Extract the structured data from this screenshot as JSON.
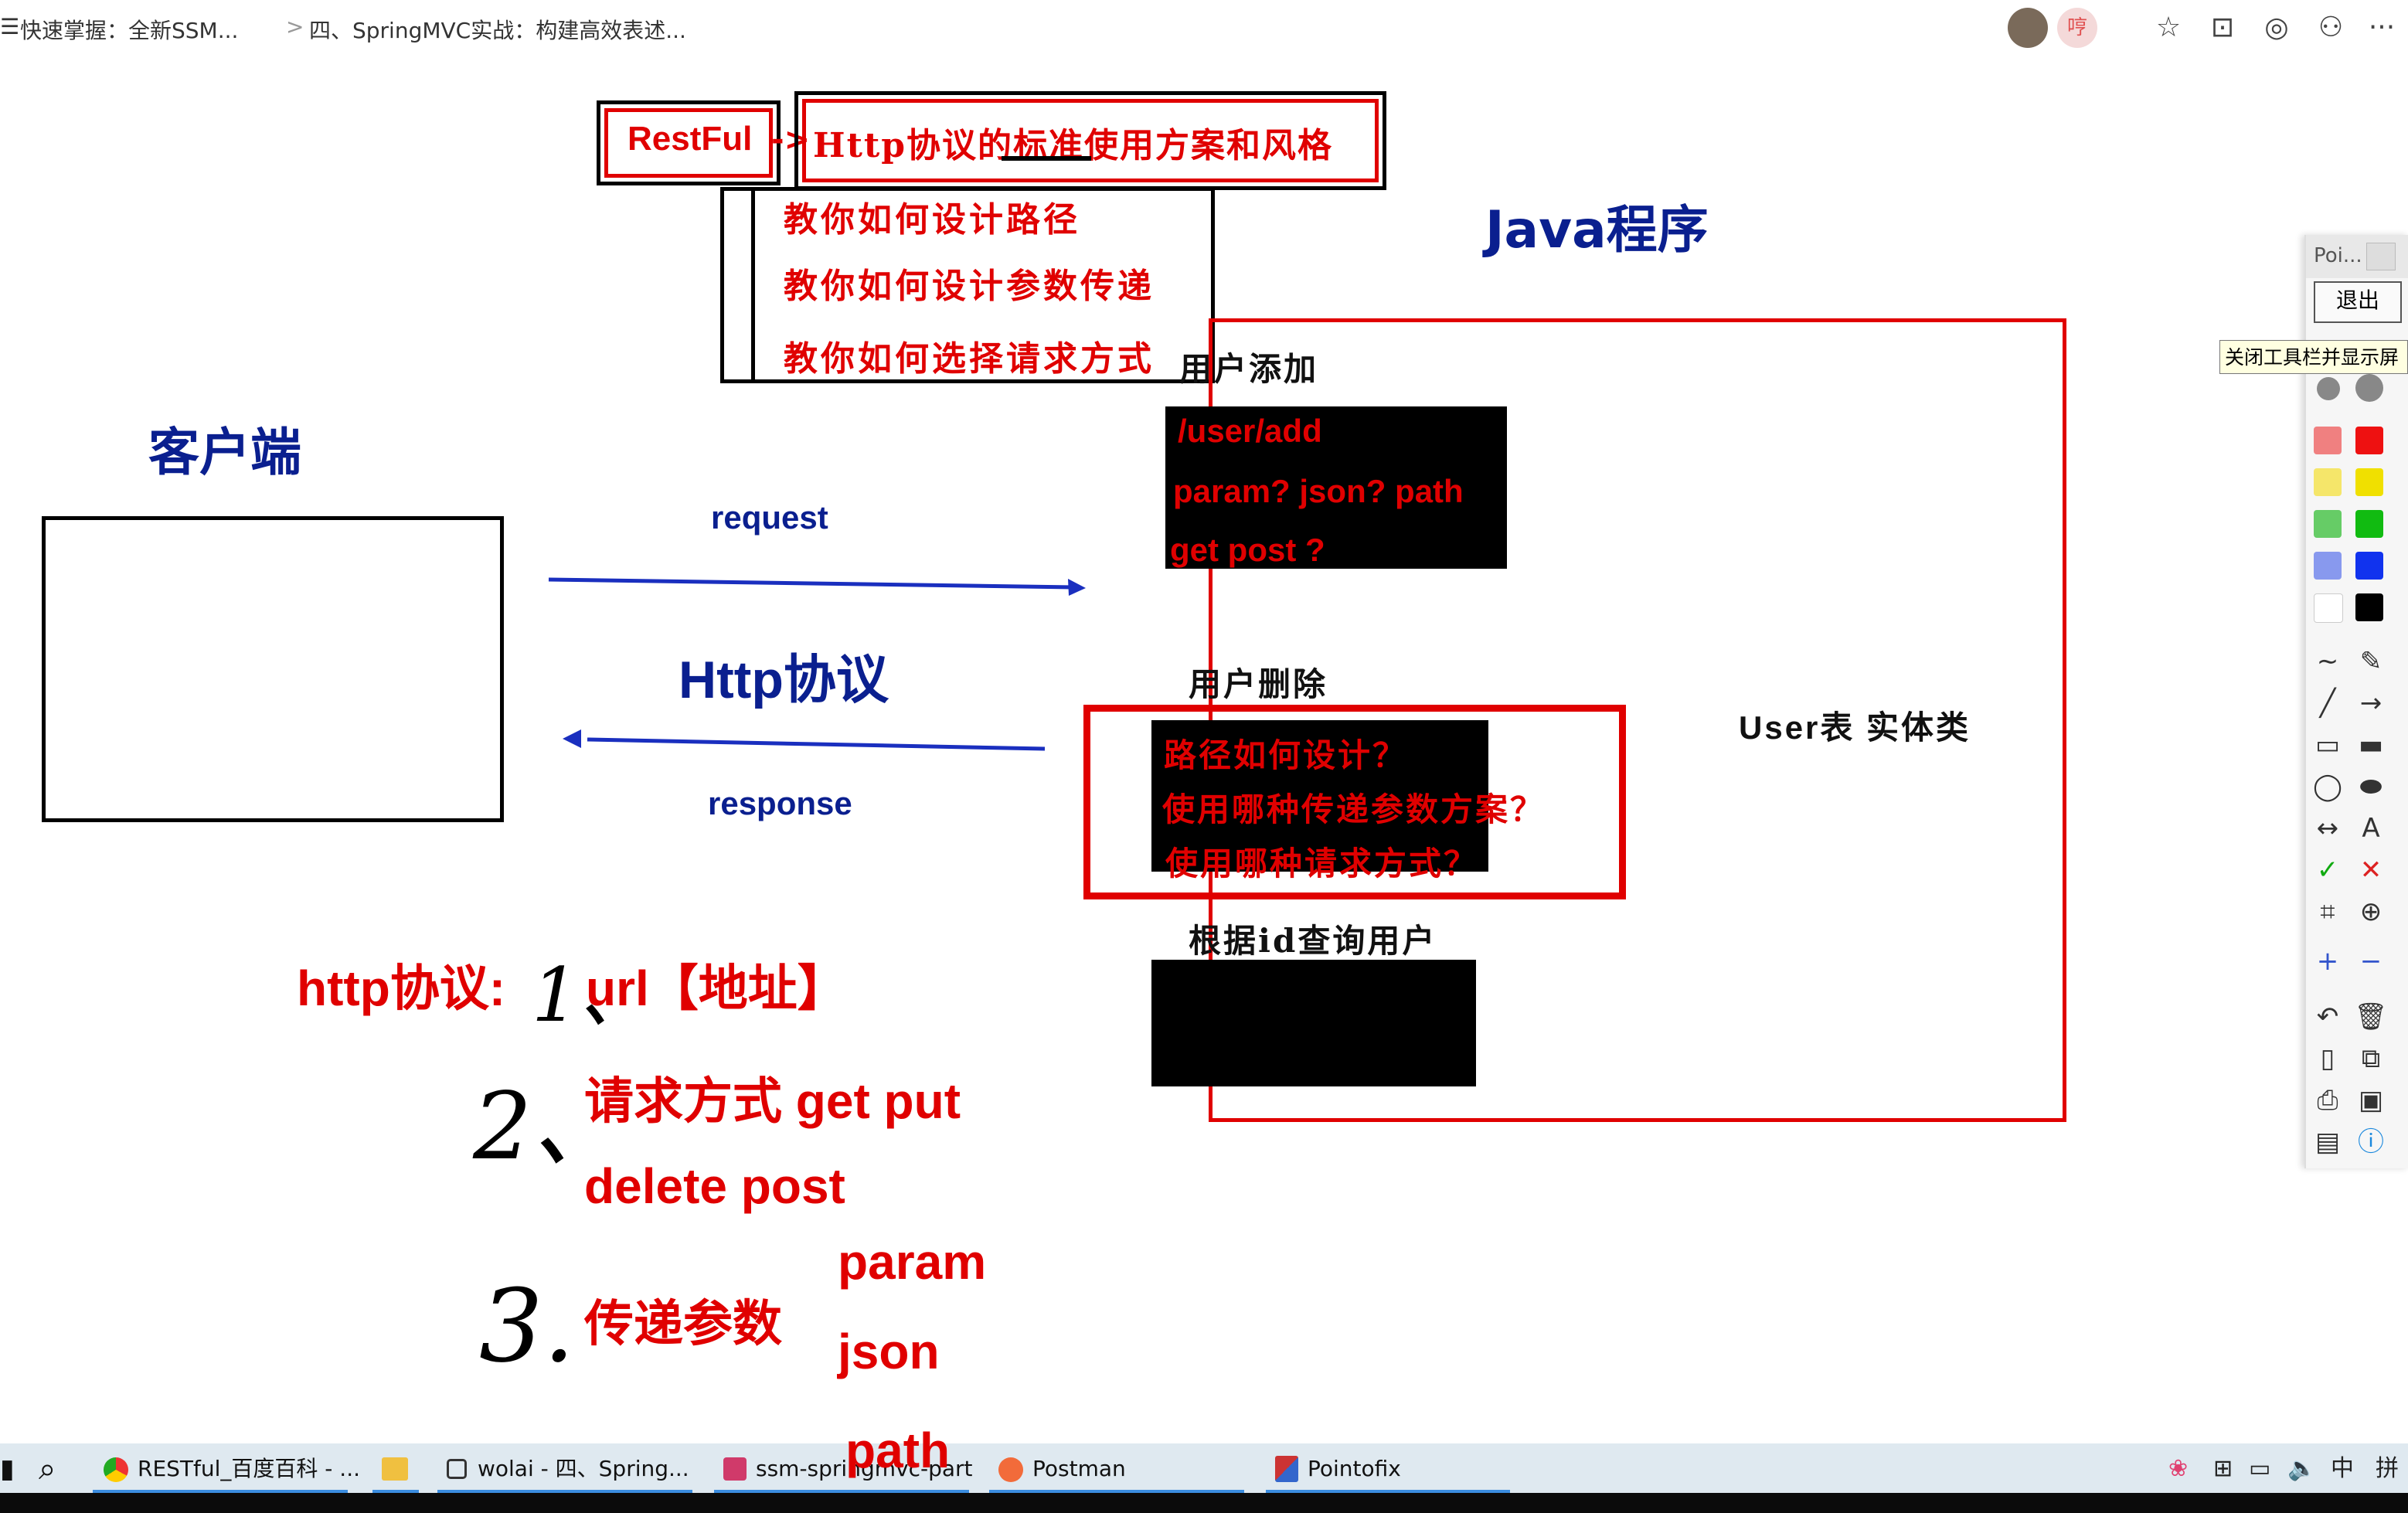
{
  "breadcrumb": {
    "menu_glyph": "☰",
    "item1": "快速掌握：全新SSM...",
    "sep": ">",
    "item2": "四、SpringMVC实战：构建高效表述..."
  },
  "topbar_icons": {
    "avatar_badge": "哼",
    "star": "☆",
    "comment": "⊡",
    "chat": "◎",
    "user": "⚇",
    "more": "···"
  },
  "slide": {
    "restful_label": "RestFul",
    "arrow": "->",
    "restful_desc": "Http协议的标准使用方案和风格",
    "teach_items": [
      "教你如何设计路径",
      "教你如何设计参数传递",
      "教你如何选择请求方式"
    ],
    "java_title": "Java程序",
    "client_title": "客户端",
    "request_label": "request",
    "http_label": "Http协议",
    "response_label": "response",
    "user_add_label": "用户添加",
    "user_add_lines": [
      "/user/add",
      "param? json? path",
      "get post ?"
    ],
    "user_delete_label": "用户删除",
    "user_delete_lines": [
      "路径如何设计？",
      "使用哪种传递参数方案？",
      "使用哪种请求方式？"
    ],
    "query_label": "根据id查询用户",
    "entity_label": "User表 实体类",
    "http_protocol_label": "http协议:",
    "hand_1": "1、",
    "url_label": "url【地址】",
    "hand_2": "2、",
    "method_line1": "请求方式 get put",
    "method_line2": "delete post",
    "hand_3": "3.",
    "param_pass_label": "传递参数",
    "param_options": [
      "param",
      "json",
      "path"
    ]
  },
  "pointofix": {
    "title": "Poi...",
    "exit_button": "退出",
    "tooltip": "关闭工具栏并显示屏",
    "colors": [
      "#f08080",
      "#ee1111",
      "#f5e66a",
      "#f0e000",
      "#66cc66",
      "#11bb11",
      "#8899ee",
      "#1133ee",
      "#ffffff",
      "#000000"
    ]
  },
  "taskbar": {
    "start": "▮",
    "search": "⌕",
    "items": [
      {
        "label": "RESTful_百度百科 - ..."
      },
      {
        "label": ""
      },
      {
        "label": "wolai - 四、Spring..."
      },
      {
        "label": "ssm-springmvc-part"
      },
      {
        "label": "Postman"
      },
      {
        "label": "Pointofix"
      }
    ],
    "tray_ime": "中",
    "tray_pinyin": "拼"
  }
}
